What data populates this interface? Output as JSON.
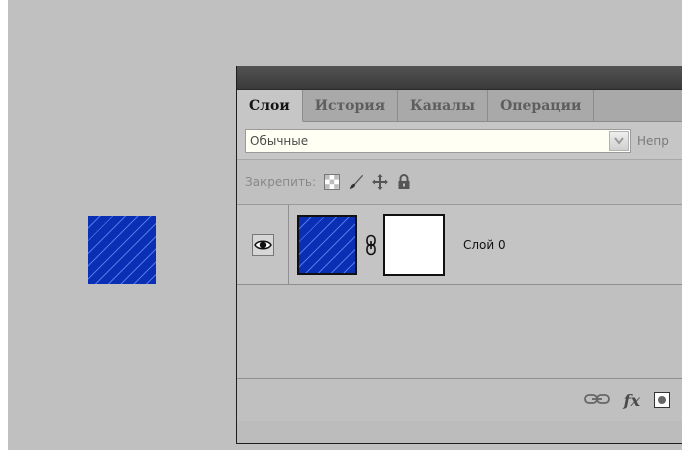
{
  "panel": {
    "tabs": [
      {
        "label": "Слои",
        "active": true
      },
      {
        "label": "История",
        "active": false
      },
      {
        "label": "Каналы",
        "active": false
      },
      {
        "label": "Операции",
        "active": false
      }
    ],
    "blend_mode": "Обычные",
    "opacity_label": "Непр",
    "lock_label": "Закрепить:",
    "lock_icons": [
      "lock-transparency-icon",
      "brush-icon",
      "move-icon",
      "padlock-icon"
    ],
    "layers": [
      {
        "name": "Слой 0",
        "visible": true,
        "has_mask": true
      }
    ],
    "bottom_icons": [
      "link-layers-icon",
      "fx-icon",
      "add-mask-icon"
    ],
    "fx_label": "fx"
  },
  "colors": {
    "canvas_bg": "#c0c0c0",
    "layer_blue": "#0a2fb5",
    "stripe": "#4f78e8"
  }
}
